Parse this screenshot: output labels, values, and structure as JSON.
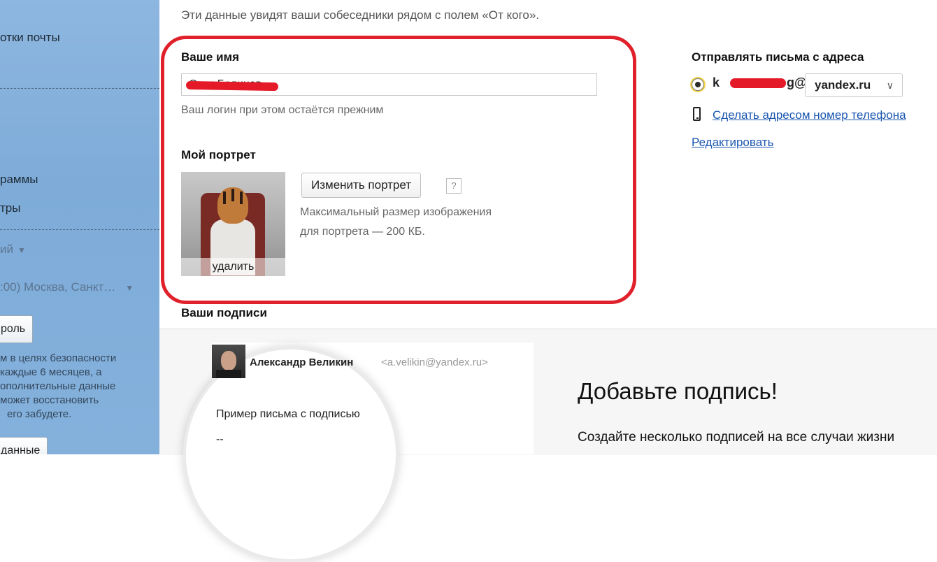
{
  "sidebar": {
    "items": [
      {
        "label": "отки почты"
      },
      {
        "label": "раммы"
      },
      {
        "label": "тры"
      }
    ],
    "language_select": "ий",
    "timezone_select": ":00) Москва, Санкт…",
    "password_button": "роль",
    "security_note": [
      "м в целях безопасности",
      "каждые 6 месяцев, а",
      "ополнительные данные",
      "может восстановить",
      "его забудете."
    ],
    "data_button": "данные"
  },
  "main": {
    "intro": "Эти данные увидят ваши собеседники рядом с полем «От кого».",
    "name_section": {
      "label": "Ваше имя",
      "value": "Олег Белинов",
      "hint": "Ваш логин при этом остаётся прежним"
    },
    "portrait_section": {
      "label": "Мой портрет",
      "delete_label": "удалить",
      "change_button": "Изменить портрет",
      "help_button": "?",
      "hint_line1": "Максимальный размер изображения",
      "hint_line2": "для портрета — 200 КБ."
    },
    "signatures": {
      "label": "Ваши подписи",
      "sender_name": "Александр Великин",
      "sender_email": "<a.velikin@yandex.ru>",
      "example_text": "Пример письма с подписью",
      "dashdash": "--",
      "promo_title": "Добавьте подпись!",
      "promo_text": "Создайте несколько подписей на все случаи жизни"
    }
  },
  "right": {
    "send_from_label": "Отправлять письма с адреса",
    "login_prefix": "k",
    "login_suffix": "g@",
    "domain": "yandex.ru",
    "phone_link": "Сделать адресом номер телефона",
    "edit_link": "Редактировать"
  },
  "colors": {
    "highlight_frame": "#e0202a",
    "link": "#1a56b0",
    "sidebar_bg": "#84b1dc"
  }
}
